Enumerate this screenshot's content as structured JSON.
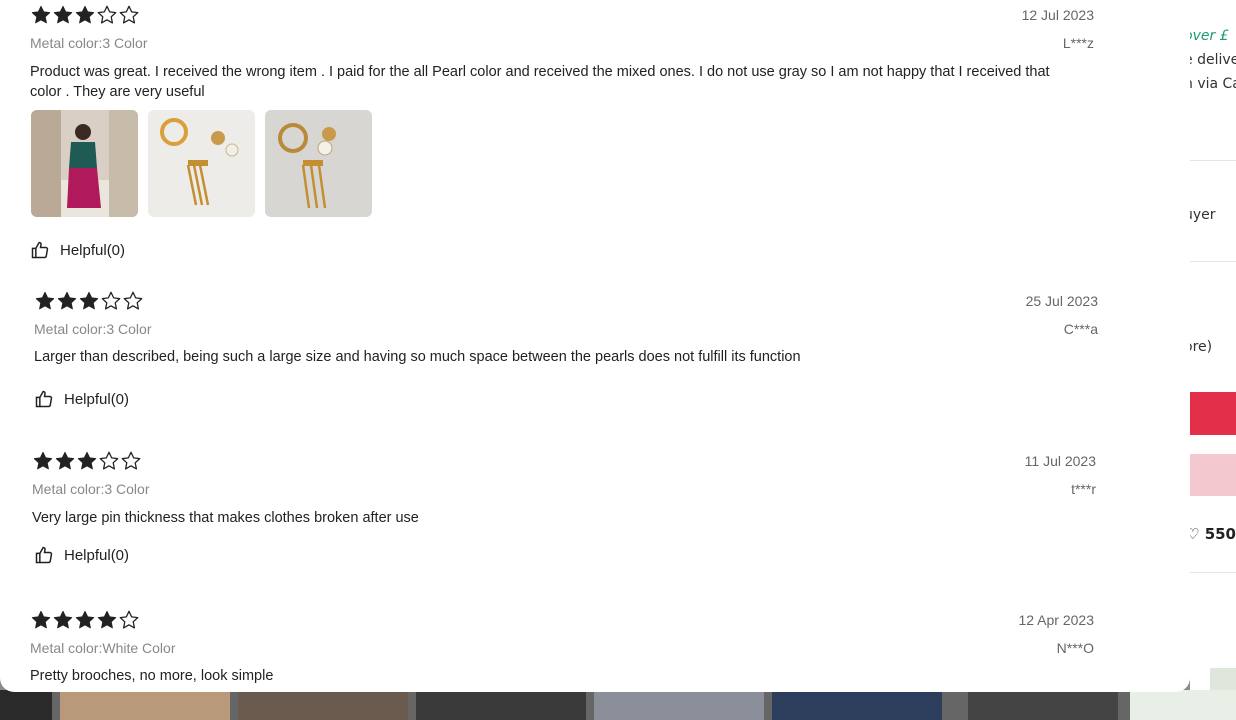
{
  "background": {
    "promo_text": "over £",
    "delivery_line": "e delive",
    "pay_line": "n via Ca",
    "buyer_text": "uyer",
    "store_text": "ore)",
    "wishlist_count": "550"
  },
  "reviews": [
    {
      "rating": 3,
      "date": "12 Jul 2023",
      "user": "L***z",
      "variant": "Metal color:3 Color",
      "text": "Product was great. I received the wrong item . I paid for the all Pearl color and received the mixed ones. I do not use gray so I am not happy that I received that color . They are very useful",
      "photos": [
        "photo-person",
        "photo-jewelry-1",
        "photo-jewelry-2"
      ],
      "helpful": "Helpful(0)"
    },
    {
      "rating": 3,
      "date": "25 Jul 2023",
      "user": "C***a",
      "variant": "Metal color:3 Color",
      "text": "Larger than described, being such a large size and having so much space between the pearls does not fulfill its function",
      "helpful": "Helpful(0)"
    },
    {
      "rating": 3,
      "date": "11 Jul 2023",
      "user": "t***r",
      "variant": "Metal color:3 Color",
      "text": "Very large pin thickness that makes clothes broken after use",
      "helpful": "Helpful(0)"
    },
    {
      "rating": 4,
      "date": "12 Apr 2023",
      "user": "N***O",
      "variant": "Metal color:White Color",
      "text": "Pretty brooches, no more, look simple"
    }
  ],
  "colors": {
    "star": "#222222",
    "accent_red": "#e2304a",
    "accent_green": "#1a9e6a"
  }
}
